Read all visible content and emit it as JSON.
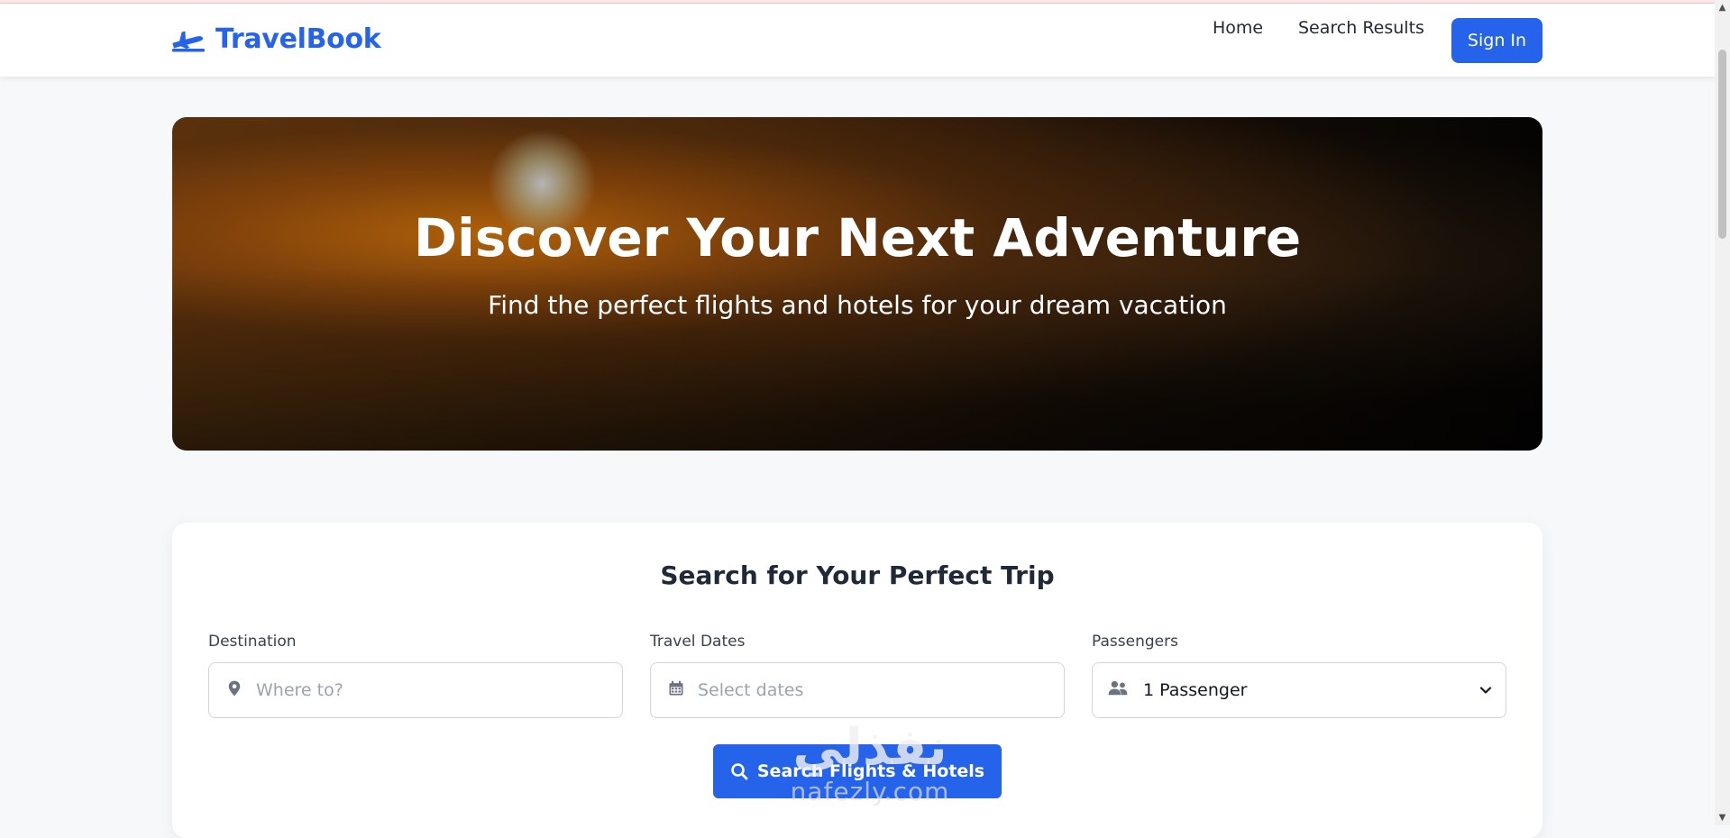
{
  "header": {
    "brand": "TravelBook",
    "nav": {
      "home": "Home",
      "search_results": "Search Results"
    },
    "sign_in_label": "Sign In"
  },
  "hero": {
    "title": "Discover Your Next Adventure",
    "subtitle": "Find the perfect flights and hotels for your dream vacation"
  },
  "search": {
    "title": "Search for Your Perfect Trip",
    "destination": {
      "label": "Destination",
      "placeholder": "Where to?",
      "icon": "map-pin-icon"
    },
    "dates": {
      "label": "Travel Dates",
      "placeholder": "Select dates",
      "icon": "calendar-icon"
    },
    "passengers": {
      "label": "Passengers",
      "selected": "1 Passenger",
      "icon": "users-icon"
    },
    "button_label": "Search Flights & Hotels"
  },
  "watermark": {
    "arabic": "نفذلي",
    "latin": "nafezly.com"
  },
  "colors": {
    "accent": "#2563eb",
    "text": "#1f2937",
    "background": "#f7f8fa"
  }
}
